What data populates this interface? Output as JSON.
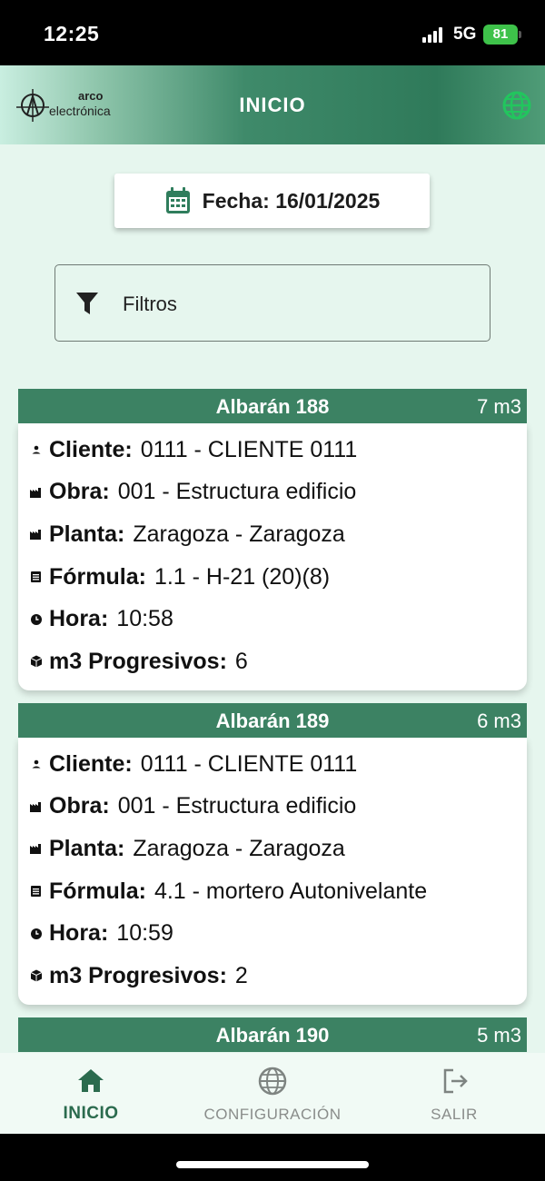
{
  "status_bar": {
    "time": "12:25",
    "network": "5G",
    "battery": "81"
  },
  "header": {
    "title": "INICIO",
    "logo_line1": "arco",
    "logo_line2": "electrónica",
    "globe_icon": "globe-icon"
  },
  "date_card": {
    "text": "Fecha: 16/01/2025",
    "icon": "calendar-icon"
  },
  "filters": {
    "label": "Filtros",
    "icon": "filter-icon"
  },
  "cards": [
    {
      "title": "Albarán 188",
      "qty": "7 m3",
      "rows": [
        {
          "label": "Cliente:",
          "value": "0111 - CLIENTE 0111",
          "icon": "person-icon"
        },
        {
          "label": "Obra:",
          "value": "001 - Estructura edificio",
          "icon": "factory-icon"
        },
        {
          "label": "Planta:",
          "value": "Zaragoza - Zaragoza",
          "icon": "factory-icon"
        },
        {
          "label": "Fórmula:",
          "value": "1.1 - H-21 (20)(8)",
          "icon": "list-icon"
        },
        {
          "label": "Hora:",
          "value": "10:58",
          "icon": "clock-icon"
        },
        {
          "label": "m3 Progresivos:",
          "value": "6",
          "icon": "cube-icon"
        }
      ]
    },
    {
      "title": "Albarán 189",
      "qty": "6 m3",
      "rows": [
        {
          "label": "Cliente:",
          "value": "0111 - CLIENTE 0111",
          "icon": "person-icon"
        },
        {
          "label": "Obra:",
          "value": "001 - Estructura edificio",
          "icon": "factory-icon"
        },
        {
          "label": "Planta:",
          "value": "Zaragoza - Zaragoza",
          "icon": "factory-icon"
        },
        {
          "label": "Fórmula:",
          "value": "4.1 - mortero Autonivelante",
          "icon": "list-icon"
        },
        {
          "label": "Hora:",
          "value": "10:59",
          "icon": "clock-icon"
        },
        {
          "label": "m3 Progresivos:",
          "value": "2",
          "icon": "cube-icon"
        }
      ]
    },
    {
      "title": "Albarán 190",
      "qty": "5 m3",
      "rows": []
    }
  ],
  "bottom_nav": [
    {
      "label": "INICIO",
      "icon": "home-icon",
      "active": true
    },
    {
      "label": "CONFIGURACIÓN",
      "icon": "globe-icon",
      "active": false
    },
    {
      "label": "SALIR",
      "icon": "logout-icon",
      "active": false
    }
  ],
  "colors": {
    "primary": "#3c8263",
    "background": "#e6f6ee",
    "nav_active": "#2b6b4e",
    "globe_accent": "#22c55e"
  }
}
